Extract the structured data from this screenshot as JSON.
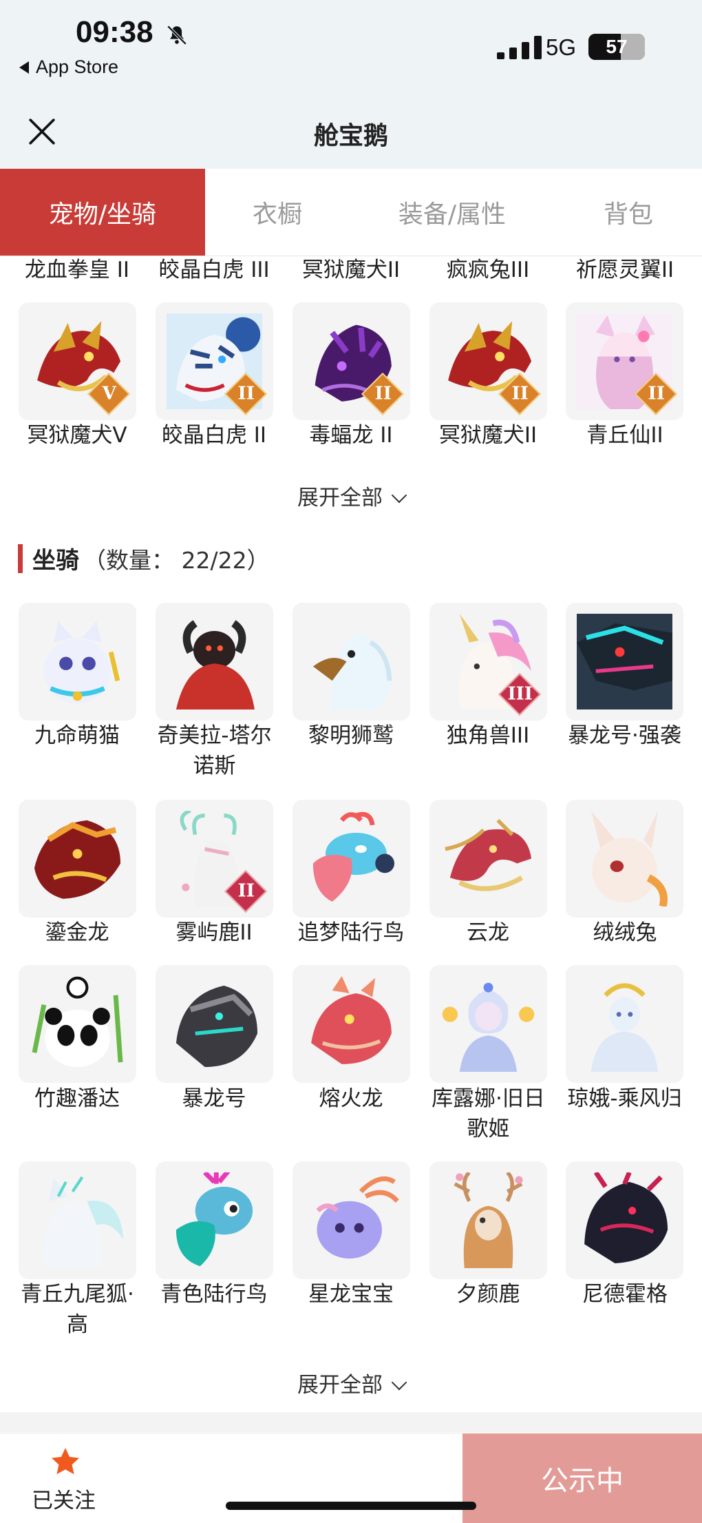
{
  "status_bar": {
    "time": "09:38",
    "back_app": "App Store",
    "network": "5G",
    "battery": "57",
    "battery_level": 0.57
  },
  "header": {
    "title": "舱宝鹅"
  },
  "tabs": [
    {
      "label": "宠物/坐骑",
      "active": true
    },
    {
      "label": "衣橱",
      "active": false
    },
    {
      "label": "装备/属性",
      "active": false
    },
    {
      "label": "背包",
      "active": false
    }
  ],
  "pets": {
    "top_row_labels": [
      "龙血拳皇 II",
      "皎晶白虎 III",
      "冥狱魔犬II",
      "疯疯兔III",
      "祈愿灵翼II"
    ],
    "row": [
      {
        "name": "冥狱魔犬V",
        "badge": "V",
        "icon": "dragon-hound-icon"
      },
      {
        "name": "皎晶白虎 II",
        "badge": "II",
        "icon": "white-tiger-icon"
      },
      {
        "name": "毒蝠龙 II",
        "badge": "II",
        "icon": "bat-dragon-icon"
      },
      {
        "name": "冥狱魔犬II",
        "badge": "II",
        "icon": "dragon-hound-icon"
      },
      {
        "name": "青丘仙II",
        "badge": "II",
        "icon": "fox-fairy-icon"
      }
    ],
    "expand_label": "展开全部"
  },
  "mounts": {
    "title": "坐骑",
    "count": "（数量： 22/22）",
    "items": [
      {
        "name": "九命萌猫",
        "icon": "white-cat-icon",
        "badge": ""
      },
      {
        "name": "奇美拉-塔尔诺斯",
        "icon": "chimera-icon",
        "badge": ""
      },
      {
        "name": "黎明狮鹫",
        "icon": "griffin-icon",
        "badge": ""
      },
      {
        "name": "独角兽III",
        "icon": "unicorn-icon",
        "badge": "III"
      },
      {
        "name": "暴龙号·强袭",
        "icon": "mech-dragon-icon",
        "badge": ""
      },
      {
        "name": "鎏金龙",
        "icon": "gold-dragon-icon",
        "badge": ""
      },
      {
        "name": "雾屿鹿II",
        "icon": "mist-deer-icon",
        "badge": "II"
      },
      {
        "name": "追梦陆行鸟",
        "icon": "dream-bird-icon",
        "badge": ""
      },
      {
        "name": "云龙",
        "icon": "cloud-dragon-icon",
        "badge": ""
      },
      {
        "name": "绒绒兔",
        "icon": "fluffy-rabbit-icon",
        "badge": ""
      },
      {
        "name": "竹趣潘达",
        "icon": "panda-icon",
        "badge": ""
      },
      {
        "name": "暴龙号",
        "icon": "mech-rex-icon",
        "badge": ""
      },
      {
        "name": "熔火龙",
        "icon": "lava-dragon-icon",
        "badge": ""
      },
      {
        "name": "库露娜·旧日歌姬",
        "icon": "diva-icon",
        "badge": ""
      },
      {
        "name": "琼娥-乘风归",
        "icon": "moon-maiden-icon",
        "badge": ""
      },
      {
        "name": "青丘九尾狐·高",
        "icon": "nine-tail-fox-icon",
        "badge": ""
      },
      {
        "name": "青色陆行鸟",
        "icon": "teal-bird-icon",
        "badge": ""
      },
      {
        "name": "星龙宝宝",
        "icon": "star-dragon-icon",
        "badge": ""
      },
      {
        "name": "夕颜鹿",
        "icon": "blossom-deer-icon",
        "badge": ""
      },
      {
        "name": "尼德霍格",
        "icon": "nidhogg-icon",
        "badge": ""
      }
    ],
    "expand_label": "展开全部"
  },
  "bottom_bar": {
    "follow_label": "已关注",
    "public_label": "公示中"
  },
  "colors": {
    "accent": "#c83b36",
    "public_button": "#e29b96",
    "tile_bg": "#f4f4f5",
    "star": "#f05a1e"
  }
}
